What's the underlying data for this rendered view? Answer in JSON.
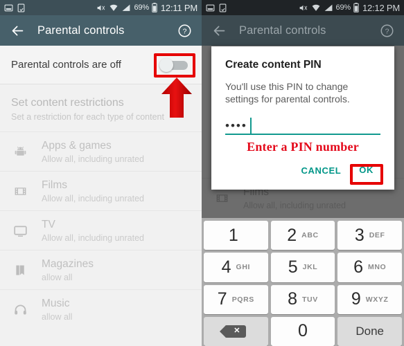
{
  "left": {
    "statusbar": {
      "notif_icons": [
        "screenshot-icon",
        "device-sync-icon"
      ],
      "vibrate_icon": "vibrate-muted-icon",
      "wifi_icon": "wifi-icon",
      "signal_icon": "signal-bars-icon",
      "battery_pct": "69%",
      "battery_icon": "battery-icon",
      "time": "12:11 PM"
    },
    "toolbar": {
      "back_icon": "back-arrow-icon",
      "title": "Parental controls",
      "help_icon": "help-circle-icon"
    },
    "master": {
      "label": "Parental controls are off",
      "toggle_state": "off"
    },
    "section": {
      "title": "Set content restrictions",
      "subtitle": "Set a restriction for each type of content"
    },
    "items": [
      {
        "icon": "android-robot-icon",
        "title": "Apps & games",
        "subtitle": "Allow all, including unrated"
      },
      {
        "icon": "film-strip-icon",
        "title": "Films",
        "subtitle": "Allow all, including unrated"
      },
      {
        "icon": "tv-icon",
        "title": "TV",
        "subtitle": "Allow all, including unrated"
      },
      {
        "icon": "book-icon",
        "title": "Magazines",
        "subtitle": "allow all"
      },
      {
        "icon": "headphones-icon",
        "title": "Music",
        "subtitle": "allow all"
      }
    ],
    "annotations": {
      "toggle_highlight_color": "#e60000",
      "arrow_color": "#d00000",
      "arrow_icon": "red-up-arrow-icon"
    }
  },
  "right": {
    "statusbar": {
      "battery_pct": "69%",
      "time": "12:12 PM"
    },
    "toolbar": {
      "back_icon": "back-arrow-icon",
      "title": "Parental controls",
      "help_icon": "help-circle-icon"
    },
    "behind_items": [
      {
        "icon": "film-strip-icon",
        "title": "Films",
        "subtitle": "Allow all, including unrated"
      }
    ],
    "dialog": {
      "title": "Create content PIN",
      "body": "You'll use this PIN to change settings for parental controls.",
      "pin_value": "••••",
      "pin_underline_color": "#11998e",
      "annotation": "Enter a PIN number",
      "annotation_color": "#e4091b",
      "cancel_label": "CANCEL",
      "ok_label": "OK",
      "button_color": "#009688",
      "ok_highlight_color": "#e60000"
    },
    "keypad": {
      "rows": [
        [
          {
            "num": "1",
            "letters": ""
          },
          {
            "num": "2",
            "letters": "ABC"
          },
          {
            "num": "3",
            "letters": "DEF"
          }
        ],
        [
          {
            "num": "4",
            "letters": "GHI"
          },
          {
            "num": "5",
            "letters": "JKL"
          },
          {
            "num": "6",
            "letters": "MNO"
          }
        ],
        [
          {
            "num": "7",
            "letters": "PQRS"
          },
          {
            "num": "8",
            "letters": "TUV"
          },
          {
            "num": "9",
            "letters": "WXYZ"
          }
        ]
      ],
      "backspace_icon": "backspace-icon",
      "zero": "0",
      "done_label": "Done"
    }
  }
}
